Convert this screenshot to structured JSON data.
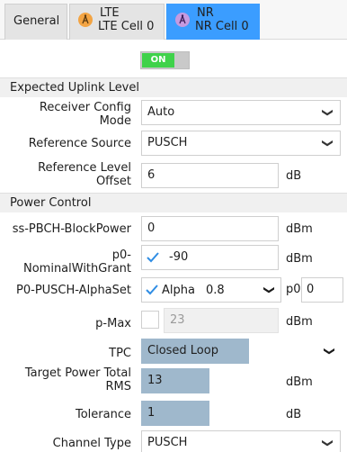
{
  "tabs": {
    "general": "General",
    "lte_line1": "LTE",
    "lte_line2": "LTE Cell 0",
    "nr_line1": "NR",
    "nr_line2": "NR Cell 0"
  },
  "toggle": {
    "label": "ON"
  },
  "sections": {
    "uplink": "Expected Uplink Level",
    "power": "Power Control"
  },
  "uplink": {
    "receiver_config_mode": {
      "label_line1": "Receiver Config",
      "label_line2": "Mode",
      "value": "Auto"
    },
    "reference_source": {
      "label": "Reference Source",
      "value": "PUSCH"
    },
    "reference_level_offset": {
      "label_line1": "Reference Level",
      "label_line2": "Offset",
      "value": "6",
      "unit": "dB"
    }
  },
  "power": {
    "ss_pbch_blockpower": {
      "label": "ss-PBCH-BlockPower",
      "value": "0",
      "unit": "dBm"
    },
    "p0_nominal": {
      "label_line1": "p0-",
      "label_line2": "NominalWithGrant",
      "value": "-90",
      "unit": "dBm",
      "checked": true
    },
    "p0_pusch_alphaset": {
      "label": "P0-PUSCH-AlphaSet",
      "alpha_label": "Alpha",
      "alpha_value": "0.8",
      "p0_label": "p0",
      "p0_value": "0"
    },
    "p_max": {
      "label": "p-Max",
      "value": "23",
      "unit": "dBm",
      "checked": false
    },
    "tpc": {
      "label": "TPC",
      "value": "Closed Loop"
    },
    "target_power": {
      "label_line1": "Target Power Total",
      "label_line2": "RMS",
      "value": "13",
      "unit": "dBm"
    },
    "tolerance": {
      "label": "Tolerance",
      "value": "1",
      "unit": "dB"
    },
    "channel_type": {
      "label": "Channel Type",
      "value": "PUSCH"
    }
  },
  "colors": {
    "active_tab": "#3b9dff",
    "toggle_on": "#3fd24a",
    "highlight_field": "#9fb8cc",
    "checkmark": "#2f8de4"
  },
  "icons": {
    "lte": "antenna-icon",
    "nr": "antenna-icon",
    "dropdown": "chevron-down-icon",
    "check": "checkmark-icon"
  }
}
